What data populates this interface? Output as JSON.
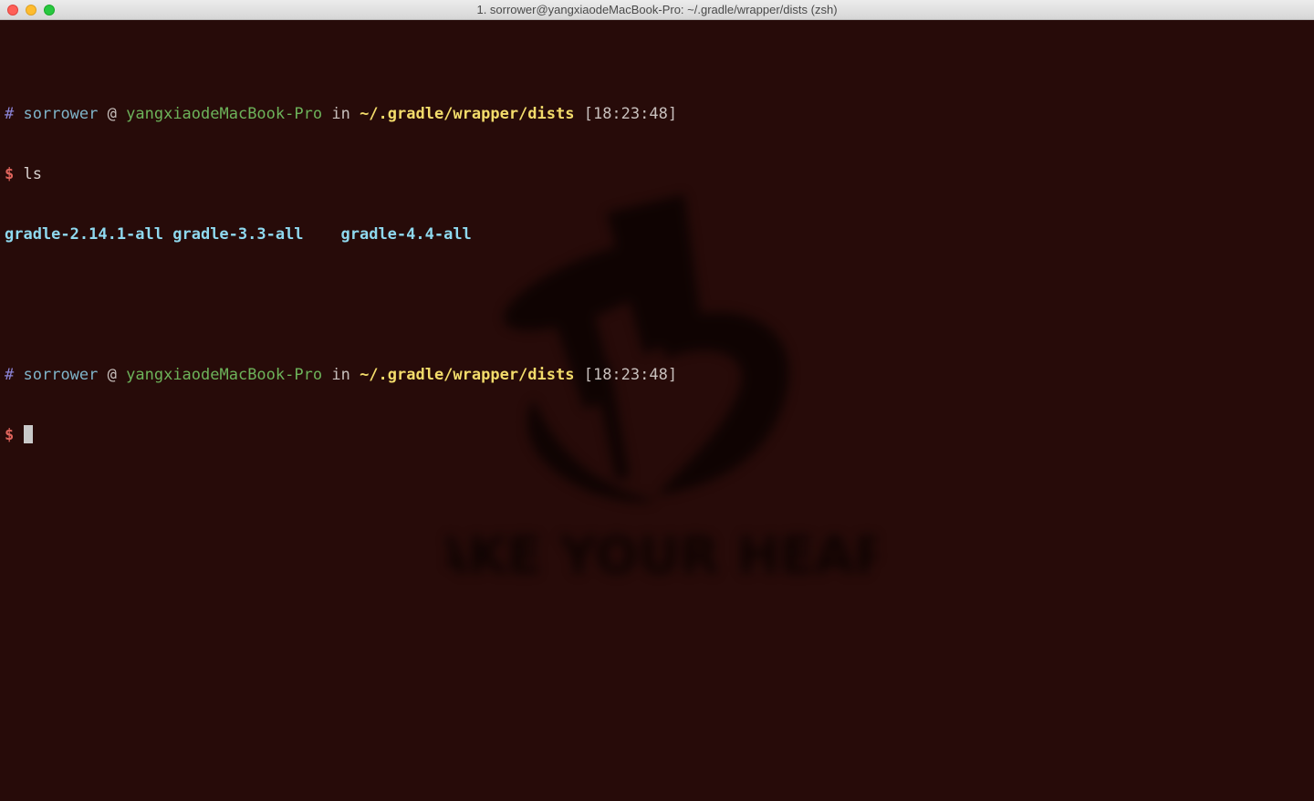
{
  "window": {
    "title": "1. sorrower@yangxiaodeMacBook-Pro: ~/.gradle/wrapper/dists (zsh)"
  },
  "prompt": {
    "hash": "#",
    "user": "sorrower",
    "at": "@",
    "host": "yangxiaodeMacBook-Pro",
    "in": "in",
    "path": "~/.gradle/wrapper/dists",
    "dollar": "$"
  },
  "session": [
    {
      "timestamp": "[18:23:48]",
      "command": "ls",
      "output": [
        "gradle-2.14.1-all",
        "gradle-3.3-all",
        "gradle-4.4-all"
      ]
    },
    {
      "timestamp": "[18:23:48]",
      "command": ""
    }
  ],
  "colors": {
    "background": "#270b09",
    "prompt_hash": "#8b84d6",
    "prompt_user": "#7fb4c9",
    "prompt_host": "#6db35a",
    "prompt_path": "#f3dc6b",
    "prompt_dollar": "#e0645c",
    "directory": "#8fd9ef"
  },
  "background_logo": {
    "icon": "top-hat-calling-card-logo",
    "text": "TAKE YOUR HEART"
  }
}
